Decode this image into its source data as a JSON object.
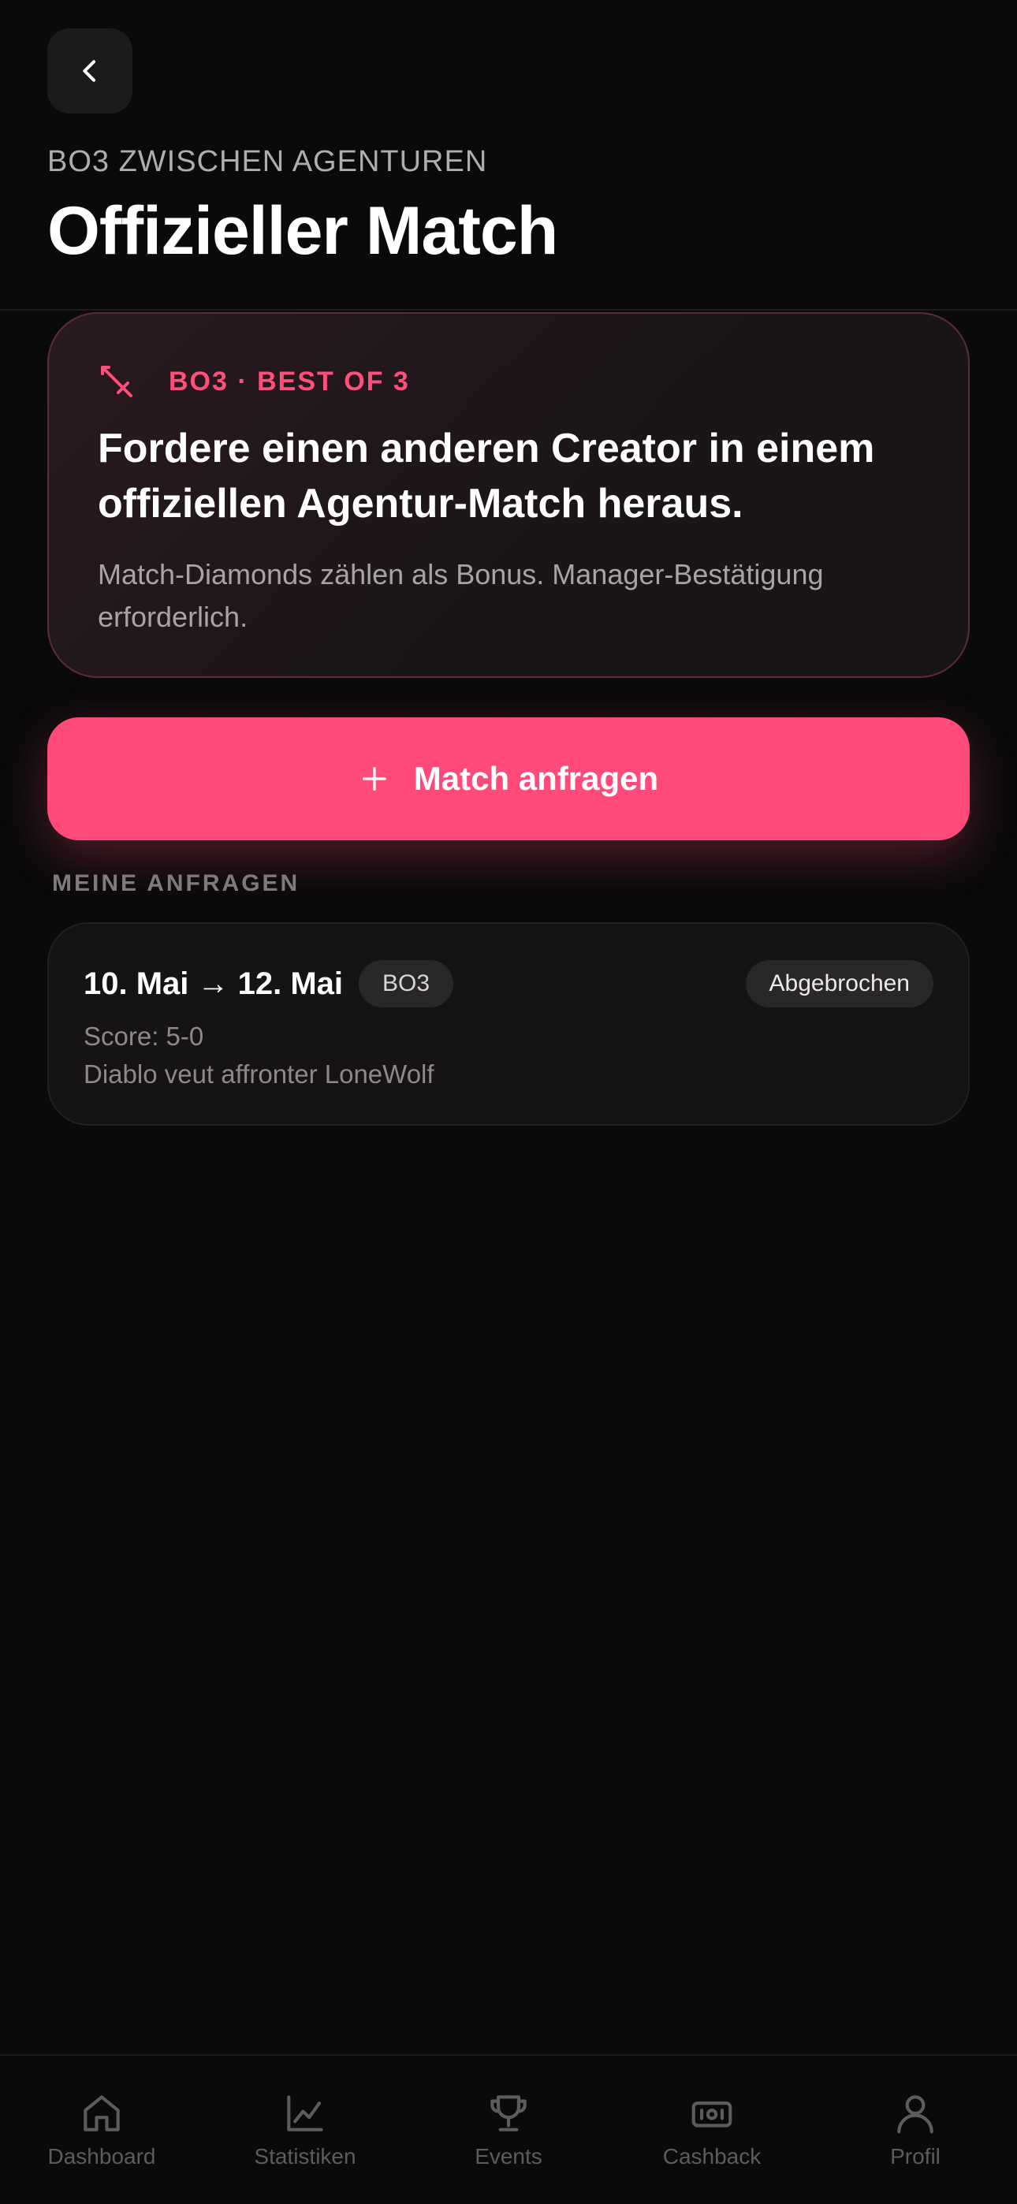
{
  "header": {
    "eyebrow": "BO3 ZWISCHEN AGENTUREN",
    "title": "Offizieller Match"
  },
  "hero": {
    "tag": "BO3 · BEST OF 3",
    "heading": "Fordere einen anderen Creator in einem offiziellen Agentur-Match heraus.",
    "description": "Match-Diamonds zählen als Bonus. Manager-Bestätigung erforderlich.",
    "icon": "sword-icon"
  },
  "cta": {
    "label": "Match anfragen",
    "icon": "plus-icon"
  },
  "requests": {
    "section_label": "MEINE ANFRAGEN",
    "items": [
      {
        "dates": "10. Mai → 12. Mai",
        "format": "BO3",
        "status": "Abgebrochen",
        "score": "Score: 5-0",
        "description": "Diablo veut affronter LoneWolf"
      }
    ]
  },
  "nav": {
    "items": [
      {
        "label": "Dashboard",
        "icon": "home-icon"
      },
      {
        "label": "Statistiken",
        "icon": "chart-icon"
      },
      {
        "label": "Events",
        "icon": "trophy-icon"
      },
      {
        "label": "Cashback",
        "icon": "cash-icon"
      },
      {
        "label": "Profil",
        "icon": "user-icon"
      }
    ]
  },
  "colors": {
    "accent": "#ff4a7a",
    "background": "#0a0a0a",
    "card": "#151315"
  }
}
